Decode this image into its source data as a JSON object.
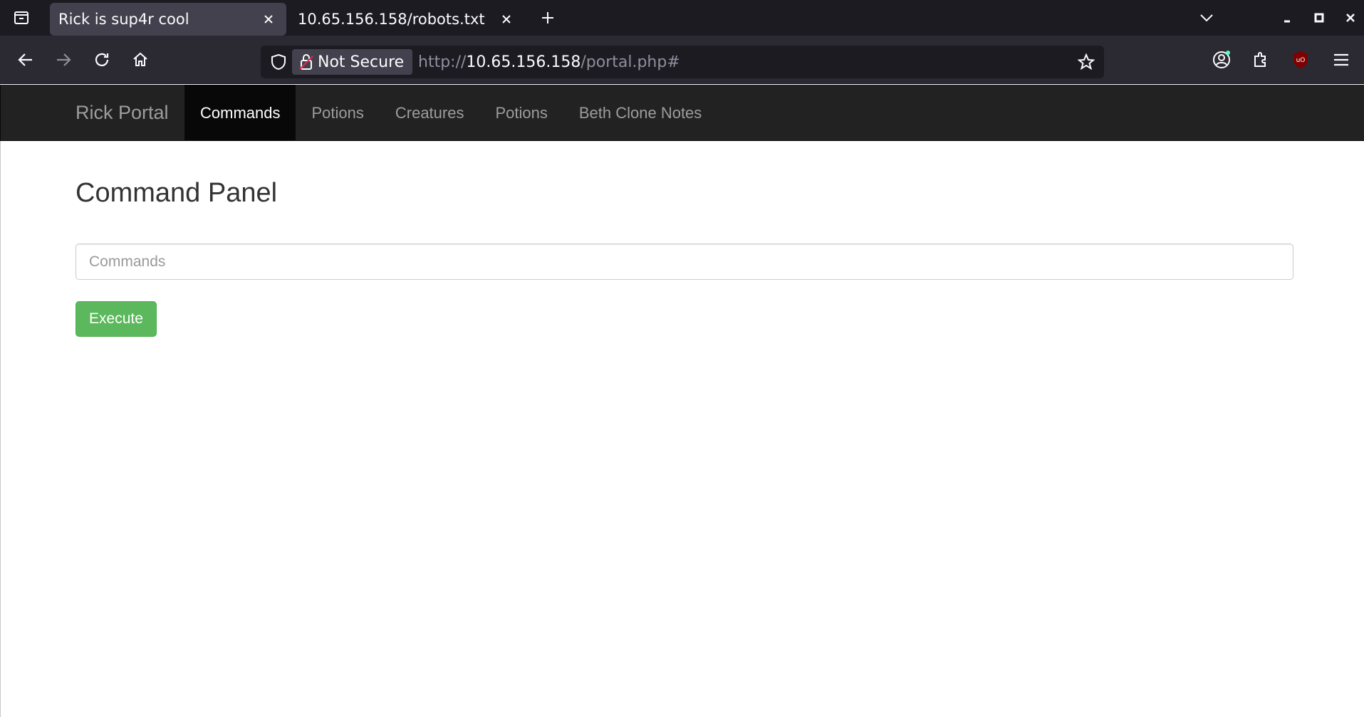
{
  "browser": {
    "tabs": [
      {
        "title": "Rick is sup4r cool",
        "active": true
      },
      {
        "title": "10.65.156.158/robots.txt",
        "active": false
      }
    ],
    "security_label": "Not Secure",
    "url": {
      "scheme": "http://",
      "host": "10.65.156.158",
      "path": "/portal.php#"
    }
  },
  "site": {
    "brand": "Rick Portal",
    "nav": [
      {
        "label": "Commands",
        "active": true
      },
      {
        "label": "Potions",
        "active": false
      },
      {
        "label": "Creatures",
        "active": false
      },
      {
        "label": "Potions",
        "active": false
      },
      {
        "label": "Beth Clone Notes",
        "active": false
      }
    ]
  },
  "main": {
    "title": "Command Panel",
    "input_placeholder": "Commands",
    "input_value": "",
    "execute_label": "Execute"
  },
  "colors": {
    "nav_background": "#222222",
    "nav_active_background": "#080808",
    "execute_button": "#5cb85c",
    "browser_tabbar": "#1c1b22",
    "browser_toolbar": "#2b2a33"
  }
}
